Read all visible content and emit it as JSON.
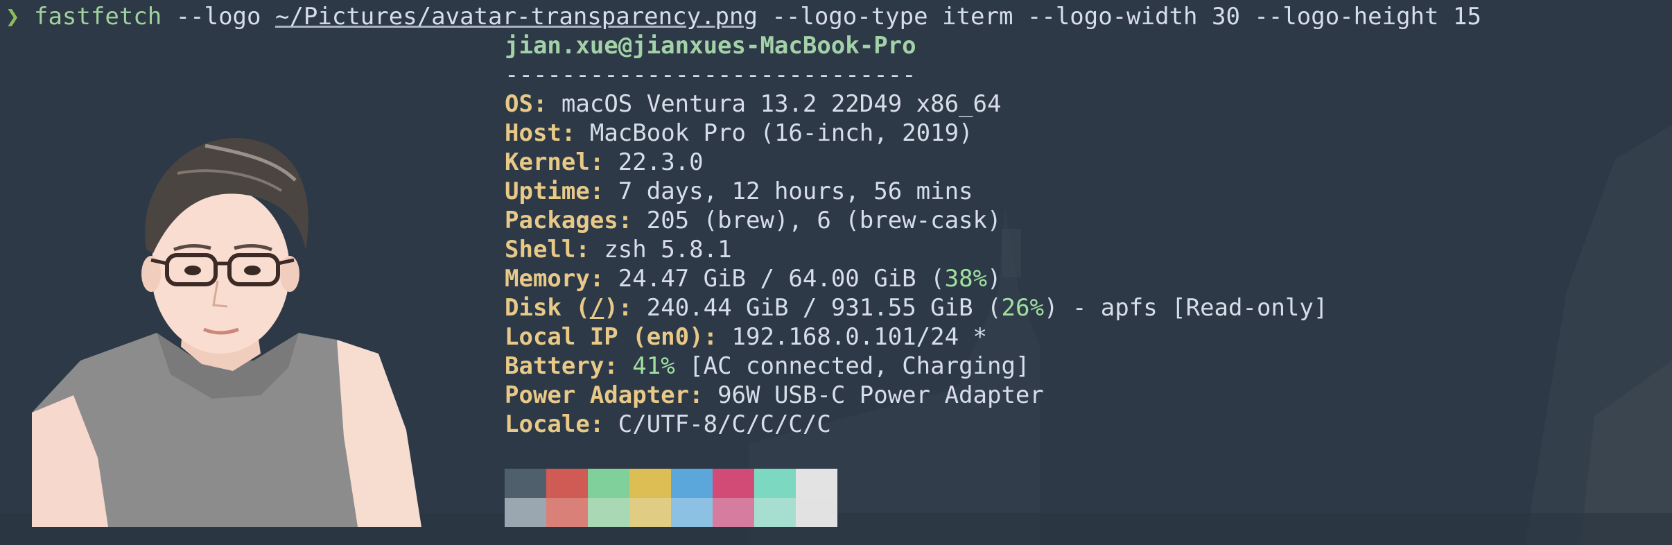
{
  "terminal": {
    "prompt_symbol": "❯",
    "command": {
      "program": "fastfetch",
      "arg1": " --logo ",
      "logo_path": "~/Pictures/avatar-transparency.png",
      "rest": " --logo-type iterm --logo-width 30 --logo-height 15"
    }
  },
  "fetch": {
    "title": "jian.xue@jianxues-MacBook-Pro",
    "separator": "-----------------------------",
    "rows": {
      "os": {
        "key": "OS",
        "value": " macOS Ventura 13.2 22D49 x86_64"
      },
      "host": {
        "key": "Host",
        "value": " MacBook Pro (16-inch, 2019)"
      },
      "kernel": {
        "key": "Kernel",
        "value": " 22.3.0"
      },
      "uptime": {
        "key": "Uptime",
        "value": " 7 days, 12 hours, 56 mins"
      },
      "packages": {
        "key": "Packages",
        "value": " 205 (brew), 6 (brew-cask)"
      },
      "shell": {
        "key": "Shell",
        "value": " zsh 5.8.1"
      },
      "memory": {
        "key": "Memory",
        "value_pre": " 24.47 GiB / 64.00 GiB (",
        "pct": "38%",
        "value_post": ")"
      },
      "disk": {
        "key_pre": "Disk (",
        "key_mount": "/",
        "key_post": ")",
        "value_pre": " 240.44 GiB / 931.55 GiB (",
        "pct": "26%",
        "value_post": ") - apfs [Read-only]"
      },
      "local_ip": {
        "key": "Local IP (en0)",
        "value": " 192.168.0.101/24 *"
      },
      "battery": {
        "key": "Battery",
        "pct": "41%",
        "value_post": " [AC connected, Charging]"
      },
      "power_adapter": {
        "key": "Power Adapter",
        "value": " 96W USB-C Power Adapter"
      },
      "locale": {
        "key": "Locale",
        "value": " C/UTF-8/C/C/C/C"
      }
    },
    "colon": ":"
  },
  "palette": {
    "top": [
      "#4f5f6c",
      "#d05b55",
      "#7fd09b",
      "#dcbe54",
      "#5ba7dc",
      "#d24a76",
      "#7dd8c2",
      "#e3e3e3"
    ],
    "bottom": [
      "#9aa6b0",
      "#d98078",
      "#a8d9b4",
      "#e0cc83",
      "#8cc1e3",
      "#d67c9e",
      "#a6dfd0",
      "#e2e2e2"
    ]
  }
}
